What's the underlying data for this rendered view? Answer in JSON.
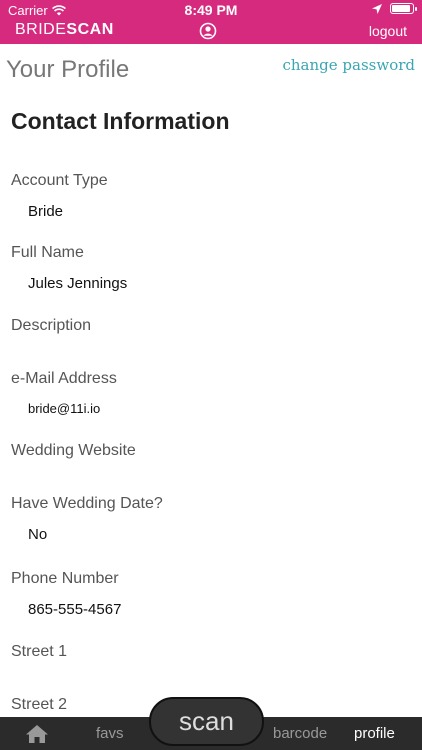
{
  "status_bar": {
    "carrier": "Carrier",
    "time": "8:49 PM"
  },
  "navbar": {
    "brand_part1": "BRIDE",
    "brand_part2": "SCAN",
    "logout_label": "logout"
  },
  "page": {
    "title": "Your Profile",
    "change_password_label": "change password"
  },
  "section": {
    "title": "Contact Information"
  },
  "fields": [
    {
      "label": "Account Type",
      "value": "Bride"
    },
    {
      "label": "Full Name",
      "value": "Jules Jennings"
    },
    {
      "label": "Description",
      "value": ""
    },
    {
      "label": "e-Mail Address",
      "value": "bride@11i.io"
    },
    {
      "label": "Wedding Website",
      "value": ""
    },
    {
      "label": "Have Wedding Date?",
      "value": "No"
    },
    {
      "label": "Phone Number",
      "value": "865-555-4567"
    },
    {
      "label": "Street 1",
      "value": ""
    },
    {
      "label": "Street 2",
      "value": ""
    }
  ],
  "tabbar": {
    "favs_label": "favs",
    "scan_label": "scan",
    "barcode_label": "barcode",
    "profile_label": "profile",
    "active_tab": "profile"
  },
  "colors": {
    "brand_pink": "#d62a7f",
    "link_teal": "#3aa6b3",
    "tabbar_bg": "#2b2b2b"
  },
  "icons": [
    "wifi-icon",
    "location-arrow-icon",
    "battery-icon",
    "user-circle-icon",
    "home-icon"
  ]
}
